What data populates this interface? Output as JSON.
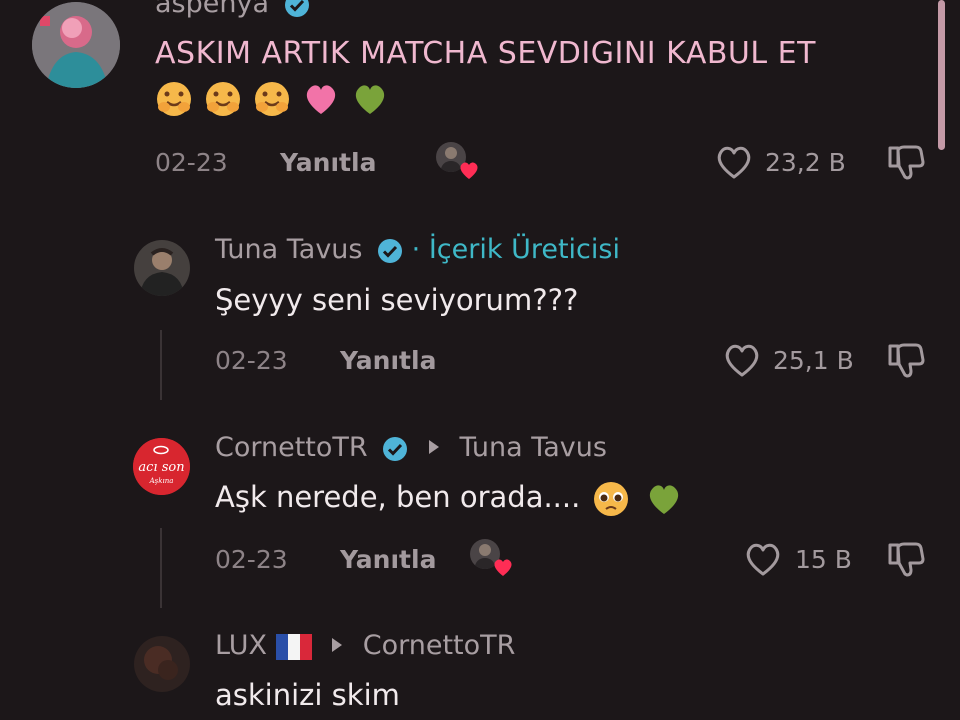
{
  "comments": [
    {
      "username": "aspenya",
      "text": "ASKIM ARTIK MATCHA SEVDIGINI KABUL ET",
      "date": "02-23",
      "reply_label": "Yanıtla",
      "likes": "23,2 B"
    },
    {
      "username": "Tuna Tavus",
      "creator_tag": "· İçerik Üreticisi",
      "text": "Şeyyy seni seviyorum???",
      "date": "02-23",
      "reply_label": "Yanıtla",
      "likes": "25,1 B"
    },
    {
      "username": "CornettoTR",
      "reply_to": "Tuna Tavus",
      "avatar_text": "acı son",
      "avatar_subtext": "Aşkına",
      "text": "Aşk nerede, ben orada....",
      "date": "02-23",
      "reply_label": "Yanıtla",
      "likes": "15 B"
    },
    {
      "username": "LUX",
      "reply_to": "CornettoTR",
      "text": "askinizi skim"
    }
  ],
  "icons": {
    "verified": "verified-check-icon",
    "like": "heart-outline-icon",
    "dislike": "thumbs-down-icon",
    "flag": "france-flag-icon",
    "emoji_hug": "hugging-face-emoji",
    "emoji_pink_heart": "pink-heart-emoji",
    "emoji_green_heart": "green-heart-emoji",
    "emoji_pleading": "pleading-face-emoji"
  },
  "colors": {
    "background": "#1c1719",
    "creator_tag": "#3fb8c7",
    "verified": "#4fb4d8",
    "reaction_heart": "#ff2d55"
  }
}
